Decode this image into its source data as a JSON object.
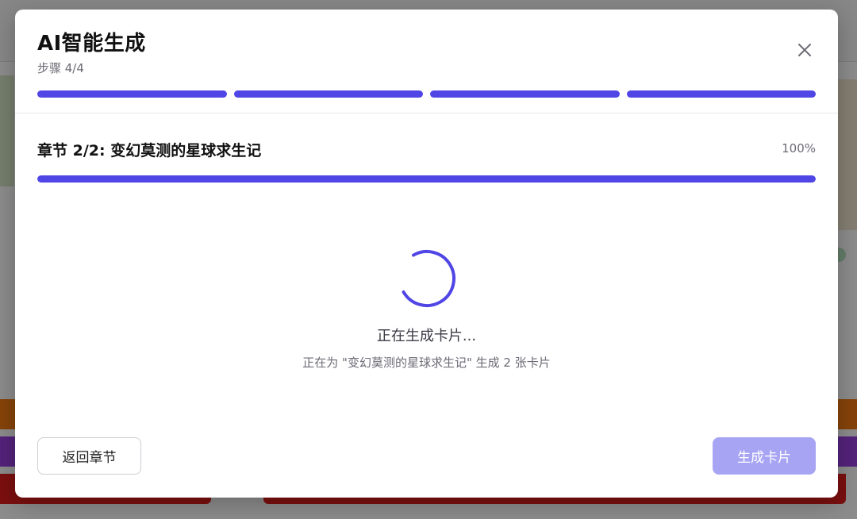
{
  "modal": {
    "title": "AI智能生成",
    "step": "步骤 4/4",
    "steps_total": 4,
    "steps_completed": 4
  },
  "chapter": {
    "title": "章节 2/2: 变幻莫测的星球求生记",
    "percent_label": "100%",
    "progress": 1.0
  },
  "status": {
    "main": "正在生成卡片...",
    "sub": "正在为 \"变幻莫测的星球求生记\" 生成 2 张卡片"
  },
  "footer": {
    "back_label": "返回章节",
    "generate_label": "生成卡片"
  },
  "colors": {
    "accent": "#5046e5",
    "accent_disabled": "#a8a4f4",
    "track": "#e3e3ea"
  },
  "icons": {
    "close": "close-icon",
    "spinner": "loading-spinner-icon"
  }
}
